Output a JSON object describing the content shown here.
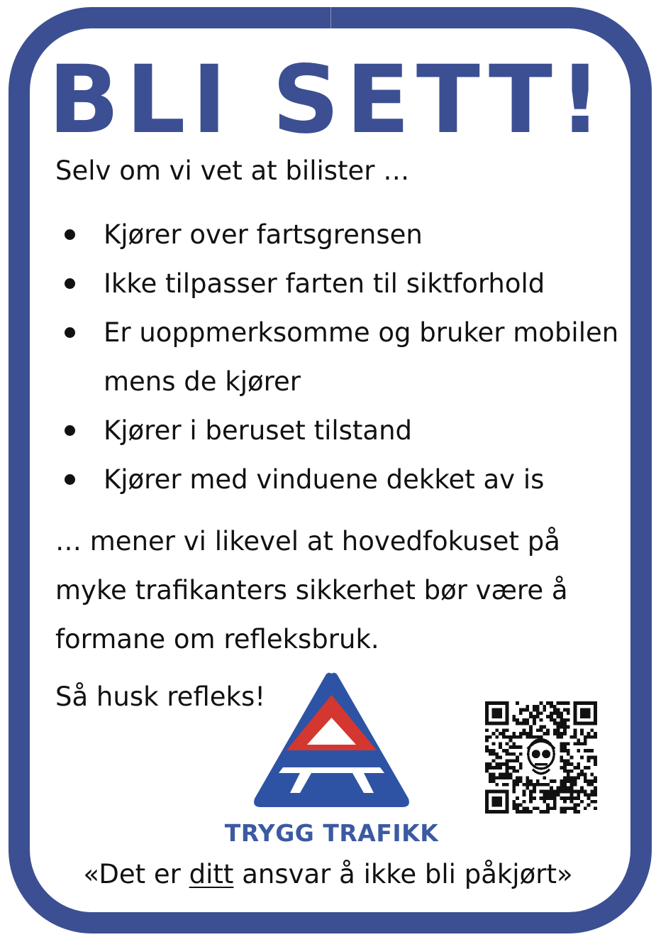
{
  "header": {
    "title": "BLI SETT!"
  },
  "intro": "Selv om vi vet at bilister …",
  "bullets": [
    "Kjører over fartsgrensen",
    "Ikke tilpasser farten til siktforhold",
    "Er uoppmerksomme og bruker mobilen mens de kjører",
    "Kjører i beruset tilstand",
    "Kjører med vinduene dekket av is"
  ],
  "conclusion": "… mener vi likevel at hovedfokuset på myke trafikanters sikkerhet bør være å formane om refleksbruk.",
  "reminder": "Så husk refleks!",
  "logo": {
    "text": "TRYGG TRAFIKK",
    "icon": "trygg-trafikk-triangle-logo"
  },
  "qr_code": {
    "icon": "qr-code"
  },
  "tagline": {
    "before": "«Det er ",
    "emphasis": "ditt",
    "after": " ansvar å ikke bli påkjørt»"
  },
  "colors": {
    "frame": "#3c4f92",
    "title": "#3c4f92",
    "logo_blue": "#2f53a4",
    "logo_red": "#d4372f",
    "logo_text": "#3c5aa1",
    "body_text": "#111111"
  }
}
